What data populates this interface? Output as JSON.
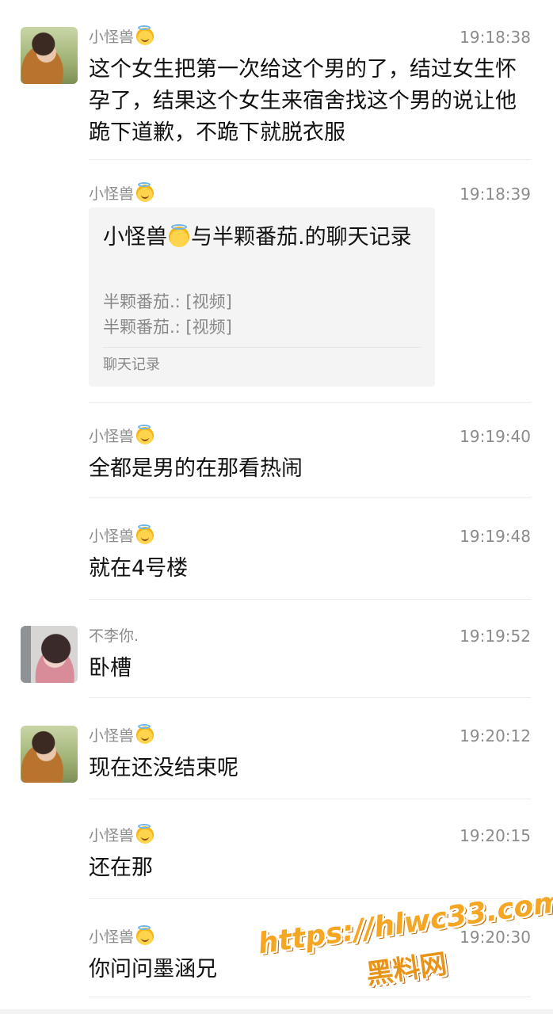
{
  "messages": [
    {
      "name": "小怪兽",
      "time": "19:18:38",
      "text": "这个女生把第一次给这个男的了，结过女生怀孕了，结果这个女生来宿舍找这个男的说让他跪下道歉，不跪下就脱衣服",
      "avatar": "girl-with-dog-avatar"
    },
    {
      "name": "小怪兽",
      "time": "19:18:39",
      "card": {
        "title_prefix": "小怪兽",
        "title_suffix": "与半颗番茄.的聊天记录",
        "lines": [
          "半颗番茄.: [视频]",
          "半颗番茄.: [视频]"
        ],
        "footer": "聊天记录"
      }
    },
    {
      "name": "小怪兽",
      "time": "19:19:40",
      "text": "全都是男的在那看热闹"
    },
    {
      "name": "小怪兽",
      "time": "19:19:48",
      "text": "就在4号楼"
    },
    {
      "name": "不李你.",
      "time": "19:19:52",
      "text": "卧槽",
      "avatar": "girl-pink-avatar"
    },
    {
      "name": "小怪兽",
      "time": "19:20:12",
      "text": "现在还没结束呢",
      "avatar": "girl-with-dog-avatar"
    },
    {
      "name": "小怪兽",
      "time": "19:20:15",
      "text": "还在那"
    },
    {
      "name": "小怪兽",
      "time": "19:20:30",
      "text": "你问问墨涵兄"
    }
  ],
  "watermark": {
    "url": "https://hlwc33.com",
    "label": "黑料网"
  }
}
